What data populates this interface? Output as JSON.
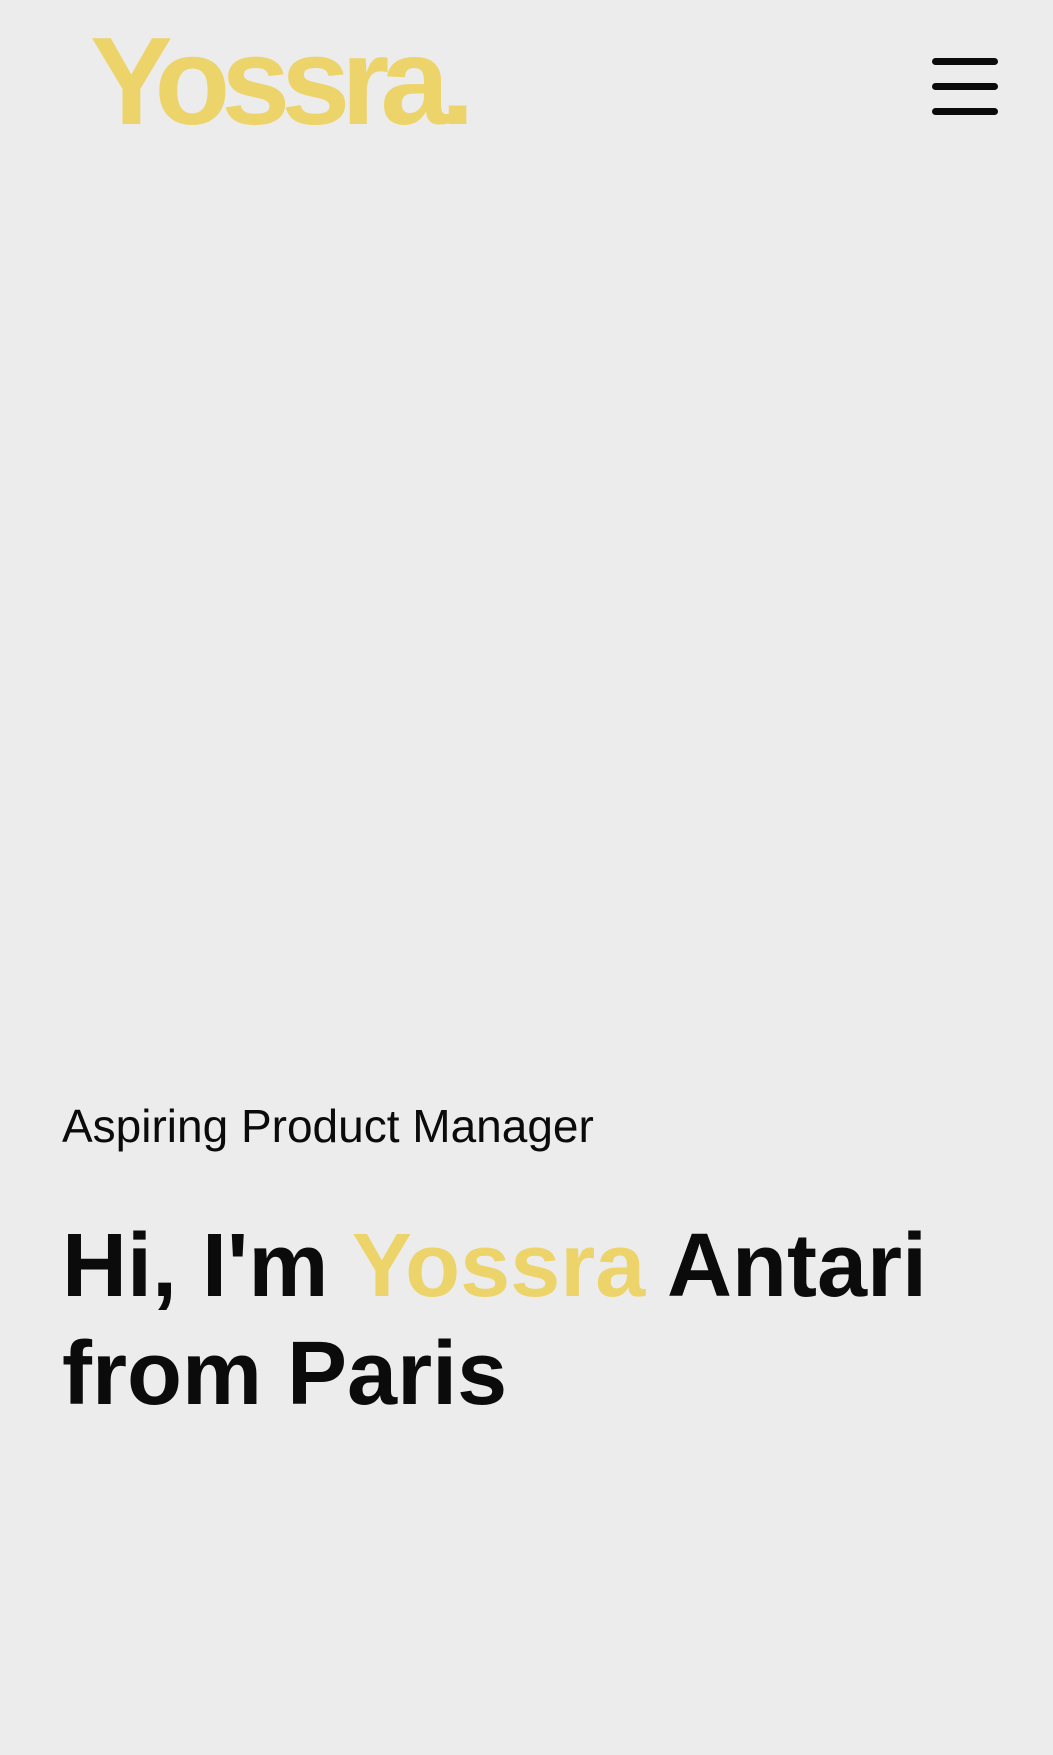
{
  "header": {
    "logo": {
      "text": "Yossra",
      "dot": ".",
      "color": "#edd46a"
    },
    "menu": {
      "icon": "hamburger-menu-icon"
    }
  },
  "hero": {
    "subtitle": "Aspiring Product Manager",
    "title": {
      "prefix": "Hi, I'm ",
      "highlight": "Yossra",
      "suffix_line1": " Antari",
      "line2": "from Paris"
    },
    "accent_color": "#edd46a"
  },
  "colors": {
    "background": "#ececec",
    "text": "#0b0b0b",
    "accent": "#edd46a"
  }
}
